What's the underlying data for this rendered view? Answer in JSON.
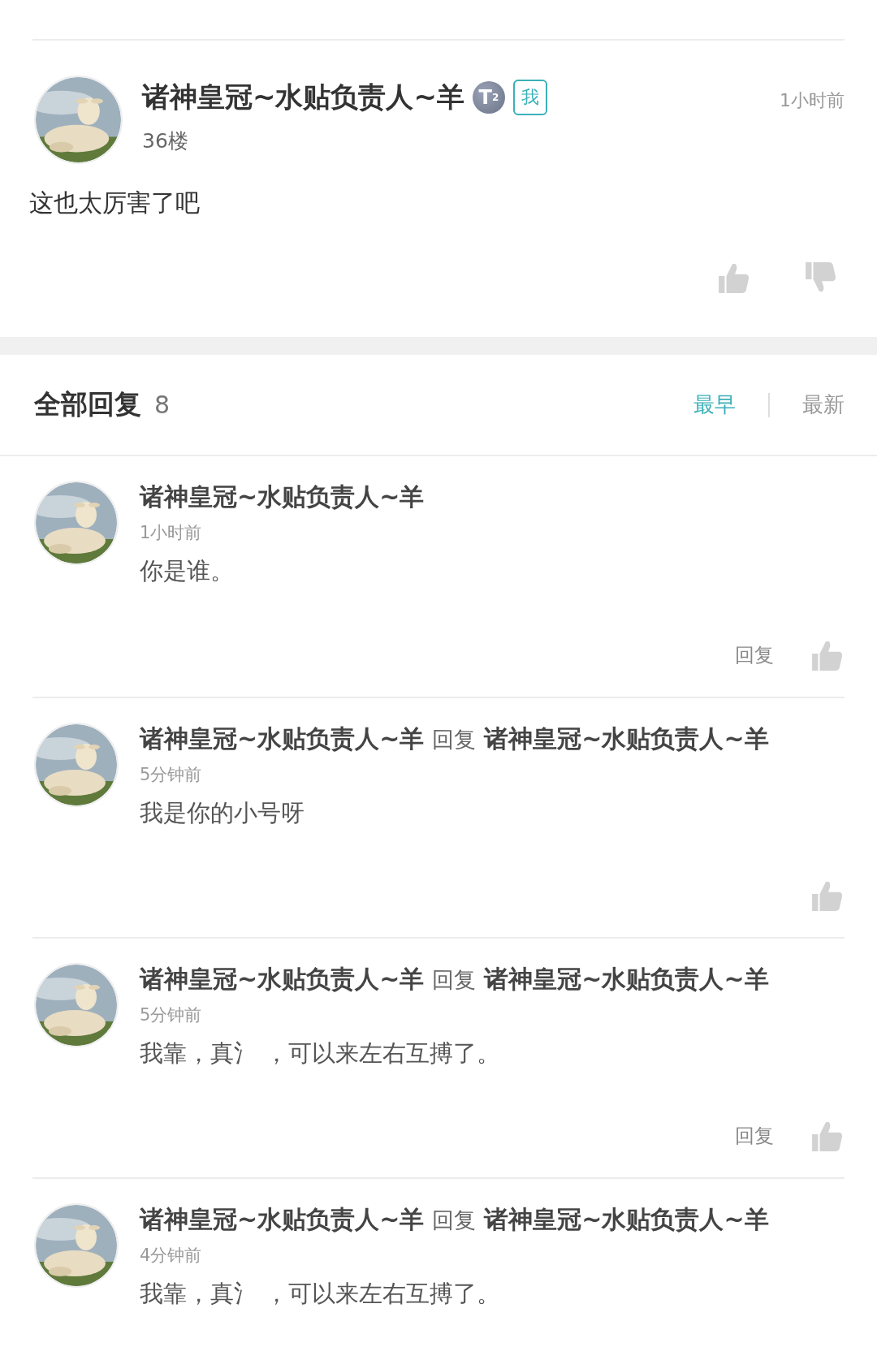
{
  "post": {
    "author": "诸神皇冠~水贴负责人~羊",
    "level_badge": {
      "letter": "T",
      "sub": "2"
    },
    "me_badge": "我",
    "floor": "36楼",
    "time": "1小时前",
    "content": "这也太厉害了吧"
  },
  "replies_header": {
    "title": "全部回复",
    "count": "8",
    "sort_tabs": [
      {
        "label": "最早",
        "selected": true
      },
      {
        "label": "最新",
        "selected": false
      }
    ]
  },
  "replies": [
    {
      "author": "诸神皇冠~水贴负责人~羊",
      "time": "1小时前",
      "content": "你是谁。",
      "reply_button": "回复"
    },
    {
      "author": "诸神皇冠~水贴负责人~羊",
      "reply_word": "回复",
      "reply_to": "诸神皇冠~水贴负责人~羊",
      "time": "5分钟前",
      "content": "我是你的小号呀"
    },
    {
      "author": "诸神皇冠~水贴负责人~羊",
      "reply_word": "回复",
      "reply_to": "诸神皇冠~水贴负责人~羊",
      "time": "5分钟前",
      "content": "我靠，真氵 ，可以来左右互搏了。",
      "reply_button": "回复"
    },
    {
      "author": "诸神皇冠~水贴负责人~羊",
      "reply_word": "回复",
      "reply_to": "诸神皇冠~水贴负责人~羊",
      "time": "4分钟前",
      "content": "我靠，真氵 ，可以来左右互搏了。"
    }
  ]
}
